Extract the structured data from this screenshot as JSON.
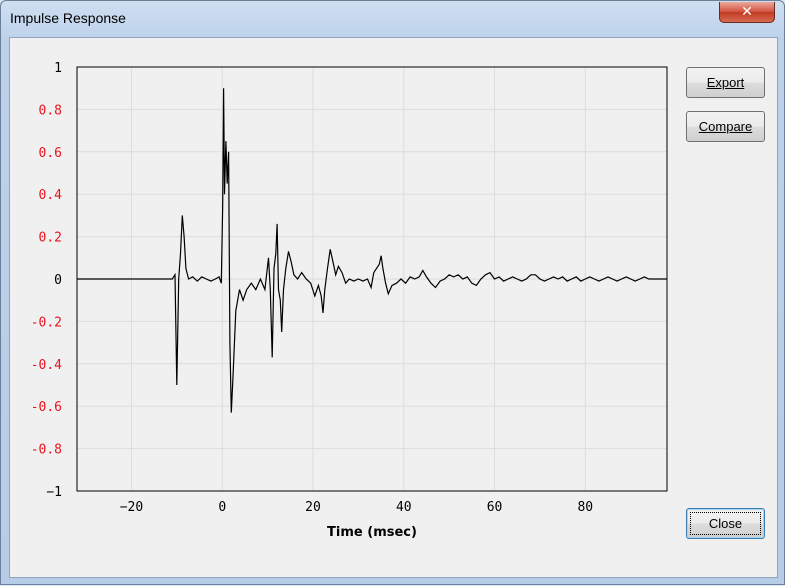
{
  "window": {
    "title": "Impulse Response",
    "close_glyph": "✕"
  },
  "buttons": {
    "export": "Export",
    "compare": "Compare",
    "close": "Close"
  },
  "colors": {
    "negative_tick": "#000000",
    "red_tick": "#e8141e",
    "trace": "#000000",
    "grid": "#dcdcdc"
  },
  "chart_data": {
    "type": "line",
    "title": "",
    "xlabel": "Time (msec)",
    "ylabel": "",
    "xlim": [
      -32,
      98
    ],
    "ylim": [
      -1,
      1
    ],
    "grid": true,
    "xticks": [
      -20,
      0,
      20,
      40,
      60,
      80
    ],
    "xtick_labels": [
      "−20",
      "0",
      "20",
      "40",
      "60",
      "80"
    ],
    "yticks": [
      1,
      0.8,
      0.6,
      0.4,
      0.2,
      0,
      -0.2,
      -0.4,
      -0.6,
      -0.8,
      -1
    ],
    "ytick_labels": [
      "1",
      "0.8",
      "0.6",
      "0.4",
      "0.2",
      "0",
      "-0.2",
      "-0.4",
      "-0.6",
      "-0.8",
      "−1"
    ],
    "red_ytick_labels": [
      "0.8",
      "0.6",
      "0.4",
      "0.2",
      "-0.2",
      "-0.4",
      "-0.6",
      "-0.8"
    ],
    "series": [
      {
        "values": [
          [
            -32,
            0
          ],
          [
            -11,
            0
          ],
          [
            -10.4,
            0.02
          ],
          [
            -10,
            -0.5
          ],
          [
            -9.6,
            0.0
          ],
          [
            -9.2,
            0.12
          ],
          [
            -8.8,
            0.3
          ],
          [
            -8.4,
            0.2
          ],
          [
            -8,
            0.05
          ],
          [
            -7.4,
            0.0
          ],
          [
            -6.5,
            0.01
          ],
          [
            -5.5,
            -0.01
          ],
          [
            -4.5,
            0.01
          ],
          [
            -3.5,
            0.0
          ],
          [
            -2.5,
            -0.01
          ],
          [
            -1.5,
            0.0
          ],
          [
            -0.7,
            0.01
          ],
          [
            -0.2,
            -0.02
          ],
          [
            0.1,
            0.35
          ],
          [
            0.3,
            0.9
          ],
          [
            0.5,
            0.4
          ],
          [
            0.8,
            0.65
          ],
          [
            1.1,
            0.45
          ],
          [
            1.4,
            0.6
          ],
          [
            1.7,
            -0.3
          ],
          [
            2.0,
            -0.63
          ],
          [
            2.4,
            -0.45
          ],
          [
            3.0,
            -0.15
          ],
          [
            3.8,
            -0.05
          ],
          [
            4.6,
            -0.1
          ],
          [
            5.4,
            -0.05
          ],
          [
            6.4,
            -0.02
          ],
          [
            7.4,
            -0.05
          ],
          [
            8.4,
            0.0
          ],
          [
            9.4,
            -0.05
          ],
          [
            10.2,
            0.1
          ],
          [
            10.6,
            -0.05
          ],
          [
            11.0,
            -0.37
          ],
          [
            11.4,
            0.05
          ],
          [
            11.8,
            0.12
          ],
          [
            12.1,
            0.26
          ],
          [
            12.4,
            -0.05
          ],
          [
            12.8,
            -0.1
          ],
          [
            13.1,
            -0.25
          ],
          [
            13.5,
            -0.05
          ],
          [
            14.0,
            0.05
          ],
          [
            14.6,
            0.13
          ],
          [
            15.2,
            0.08
          ],
          [
            15.8,
            0.02
          ],
          [
            16.6,
            0.0
          ],
          [
            17.5,
            0.03
          ],
          [
            18.5,
            0.0
          ],
          [
            19.5,
            -0.02
          ],
          [
            20.4,
            -0.08
          ],
          [
            21.2,
            -0.03
          ],
          [
            21.8,
            -0.08
          ],
          [
            22.2,
            -0.16
          ],
          [
            22.6,
            -0.05
          ],
          [
            23.2,
            0.05
          ],
          [
            23.8,
            0.14
          ],
          [
            24.4,
            0.08
          ],
          [
            25.0,
            0.02
          ],
          [
            25.6,
            0.06
          ],
          [
            26.4,
            0.03
          ],
          [
            27.2,
            -0.02
          ],
          [
            28.0,
            0.0
          ],
          [
            29.0,
            -0.01
          ],
          [
            30.0,
            0.0
          ],
          [
            31.0,
            -0.01
          ],
          [
            32.0,
            0.0
          ],
          [
            32.8,
            -0.04
          ],
          [
            33.4,
            0.03
          ],
          [
            34.0,
            0.05
          ],
          [
            34.6,
            0.07
          ],
          [
            35.0,
            0.11
          ],
          [
            35.4,
            0.05
          ],
          [
            36.0,
            -0.02
          ],
          [
            36.6,
            -0.07
          ],
          [
            37.4,
            -0.03
          ],
          [
            38.4,
            -0.02
          ],
          [
            39.4,
            0.0
          ],
          [
            40.4,
            -0.02
          ],
          [
            41.4,
            0.01
          ],
          [
            42.4,
            0.0
          ],
          [
            43.4,
            0.01
          ],
          [
            44.2,
            0.04
          ],
          [
            45.0,
            0.01
          ],
          [
            46.0,
            -0.02
          ],
          [
            47.0,
            -0.04
          ],
          [
            48.0,
            -0.01
          ],
          [
            49.0,
            0.0
          ],
          [
            50.0,
            0.02
          ],
          [
            51.0,
            0.01
          ],
          [
            52.0,
            0.02
          ],
          [
            53.0,
            0.0
          ],
          [
            54.0,
            0.01
          ],
          [
            55.0,
            -0.02
          ],
          [
            56.0,
            -0.03
          ],
          [
            57.0,
            0.0
          ],
          [
            58.0,
            0.02
          ],
          [
            59.0,
            0.03
          ],
          [
            60.0,
            0.0
          ],
          [
            61.0,
            0.01
          ],
          [
            62.0,
            -0.01
          ],
          [
            63.0,
            0.0
          ],
          [
            64.0,
            0.01
          ],
          [
            65.0,
            0.0
          ],
          [
            66.0,
            -0.01
          ],
          [
            67.0,
            0.0
          ],
          [
            68.0,
            0.02
          ],
          [
            69.0,
            0.02
          ],
          [
            70.0,
            0.0
          ],
          [
            71.0,
            -0.01
          ],
          [
            72.0,
            0.0
          ],
          [
            73.0,
            0.01
          ],
          [
            74.0,
            0.0
          ],
          [
            75.0,
            0.01
          ],
          [
            76.0,
            -0.01
          ],
          [
            77.0,
            0.0
          ],
          [
            78.0,
            0.01
          ],
          [
            79.0,
            -0.01
          ],
          [
            80.0,
            0.0
          ],
          [
            81.0,
            0.01
          ],
          [
            82.0,
            0.0
          ],
          [
            83.0,
            -0.01
          ],
          [
            84.0,
            0.0
          ],
          [
            85.0,
            0.01
          ],
          [
            86.0,
            0.0
          ],
          [
            87.0,
            -0.01
          ],
          [
            88.0,
            0.0
          ],
          [
            89.0,
            0.01
          ],
          [
            90.0,
            0.0
          ],
          [
            91.0,
            -0.01
          ],
          [
            92.0,
            0.0
          ],
          [
            93.0,
            0.01
          ],
          [
            94.0,
            0.0
          ],
          [
            95.0,
            0.0
          ],
          [
            96.0,
            0.0
          ],
          [
            98.0,
            0.0
          ]
        ]
      }
    ]
  }
}
